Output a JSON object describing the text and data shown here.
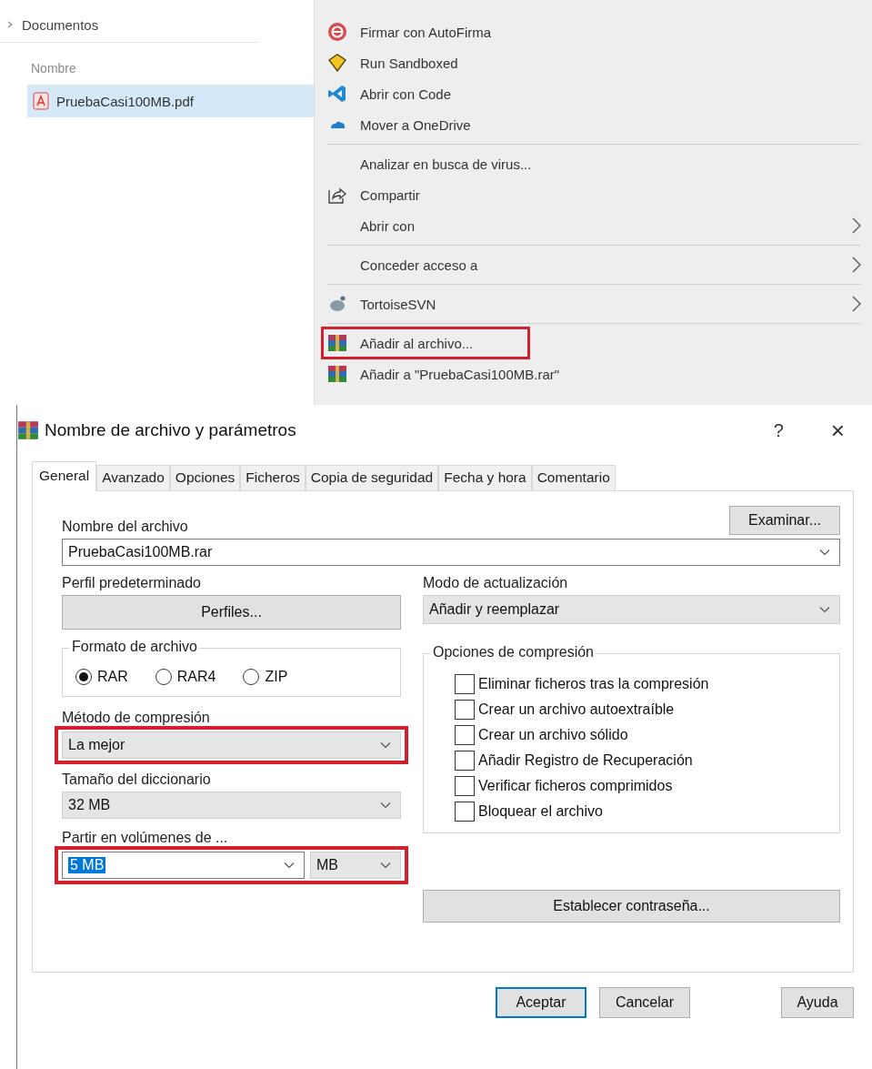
{
  "explorer": {
    "tree_item": "Documentos",
    "column_header": "Nombre",
    "files": [
      {
        "name": "PruebaCasi100MB.pdf",
        "selected": true
      }
    ]
  },
  "context_menu": {
    "groups": [
      {
        "items": [
          {
            "label": "Firmar con AutoFirma",
            "submenu": false,
            "highlighted": false
          },
          {
            "label": "Run Sandboxed",
            "submenu": false,
            "highlighted": false
          },
          {
            "label": "Abrir con Code",
            "submenu": false,
            "highlighted": false
          },
          {
            "label": "Mover a OneDrive",
            "submenu": false,
            "highlighted": false
          }
        ]
      },
      {
        "items": [
          {
            "label": "Analizar en busca de virus...",
            "submenu": false,
            "highlighted": false
          },
          {
            "label": "Compartir",
            "submenu": false,
            "highlighted": false
          },
          {
            "label": "Abrir con",
            "submenu": true,
            "highlighted": false
          }
        ]
      },
      {
        "items": [
          {
            "label": "Conceder acceso a",
            "submenu": true,
            "highlighted": false
          }
        ]
      },
      {
        "items": [
          {
            "label": "TortoiseSVN",
            "submenu": true,
            "highlighted": false
          }
        ]
      },
      {
        "items": [
          {
            "label": "Añadir al archivo...",
            "submenu": false,
            "highlighted": true
          },
          {
            "label": "Añadir a \"PruebaCasi100MB.rar\"",
            "submenu": false,
            "highlighted": false
          }
        ]
      }
    ]
  },
  "dialog": {
    "title": "Nombre de archivo y parámetros",
    "help_button": "?",
    "close_button": "×",
    "tabs": [
      {
        "label": "General",
        "selected": true
      },
      {
        "label": "Avanzado",
        "selected": false
      },
      {
        "label": "Opciones",
        "selected": false
      },
      {
        "label": "Ficheros",
        "selected": false
      },
      {
        "label": "Copia de seguridad",
        "selected": false
      },
      {
        "label": "Fecha y hora",
        "selected": false
      },
      {
        "label": "Comentario",
        "selected": false
      }
    ],
    "archive_name": {
      "label": "Nombre del archivo",
      "value": "PruebaCasi100MB.rar",
      "browse_button": "Examinar..."
    },
    "profile": {
      "label": "Perfil predeterminado",
      "button": "Perfiles..."
    },
    "update_mode": {
      "label": "Modo de actualización",
      "value": "Añadir y reemplazar"
    },
    "format": {
      "label": "Formato de archivo",
      "options": [
        {
          "label": "RAR",
          "selected": true
        },
        {
          "label": "RAR4",
          "selected": false
        },
        {
          "label": "ZIP",
          "selected": false
        }
      ]
    },
    "compression_options": {
      "label": "Opciones de compresión",
      "options": [
        {
          "label": "Eliminar ficheros tras la compresión",
          "checked": false
        },
        {
          "label": "Crear un archivo autoextraíble",
          "checked": false
        },
        {
          "label": "Crear un archivo sólido",
          "checked": false
        },
        {
          "label": "Añadir Registro de Recuperación",
          "checked": false
        },
        {
          "label": "Verificar ficheros comprimidos",
          "checked": false
        },
        {
          "label": "Bloquear el archivo",
          "checked": false
        }
      ]
    },
    "method": {
      "label": "Método de compresión",
      "value": "La mejor",
      "highlighted": true
    },
    "dictionary": {
      "label": "Tamaño del diccionario",
      "value": "32 MB"
    },
    "volumes": {
      "label": "Partir en volúmenes de ...",
      "value": "5 MB",
      "unit": "MB",
      "highlighted": true
    },
    "password_button": "Establecer contraseña...",
    "buttons": [
      {
        "label": "Aceptar",
        "kind": "primary"
      },
      {
        "label": "Cancelar",
        "kind": "normal"
      },
      {
        "label": "Ayuda",
        "kind": "spaced"
      }
    ]
  }
}
